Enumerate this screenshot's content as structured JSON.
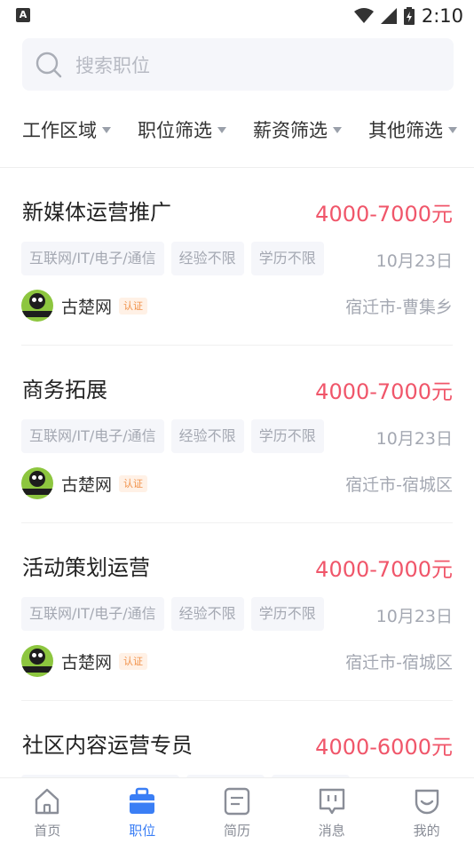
{
  "status_bar": {
    "app_indicator": "A",
    "time": "2:10"
  },
  "search": {
    "placeholder": "搜索职位"
  },
  "filters": [
    {
      "label": "工作区域"
    },
    {
      "label": "职位筛选"
    },
    {
      "label": "薪资筛选"
    },
    {
      "label": "其他筛选"
    }
  ],
  "jobs": [
    {
      "title": "新媒体运营推广",
      "salary": "4000-7000元",
      "tags": [
        "互联网/IT/电子/通信",
        "经验不限",
        "学历不限"
      ],
      "date": "10月23日",
      "company": "古楚网",
      "badge": "认证",
      "location": "宿迁市-曹集乡"
    },
    {
      "title": "商务拓展",
      "salary": "4000-7000元",
      "tags": [
        "互联网/IT/电子/通信",
        "经验不限",
        "学历不限"
      ],
      "date": "10月23日",
      "company": "古楚网",
      "badge": "认证",
      "location": "宿迁市-宿城区"
    },
    {
      "title": "活动策划运营",
      "salary": "4000-7000元",
      "tags": [
        "互联网/IT/电子/通信",
        "经验不限",
        "学历不限"
      ],
      "date": "10月23日",
      "company": "古楚网",
      "badge": "认证",
      "location": "宿迁市-宿城区"
    },
    {
      "title": "社区内容运营专员",
      "salary": "4000-6000元",
      "tags": [
        "",
        "",
        ""
      ],
      "date": "",
      "company": "",
      "badge": "",
      "location": ""
    }
  ],
  "tab_bar": {
    "active_color": "#3a7ef5",
    "items": [
      {
        "label": "首页",
        "icon": "home-icon"
      },
      {
        "label": "职位",
        "icon": "briefcase-icon"
      },
      {
        "label": "简历",
        "icon": "resume-icon"
      },
      {
        "label": "消息",
        "icon": "message-icon"
      },
      {
        "label": "我的",
        "icon": "profile-icon"
      }
    ]
  }
}
